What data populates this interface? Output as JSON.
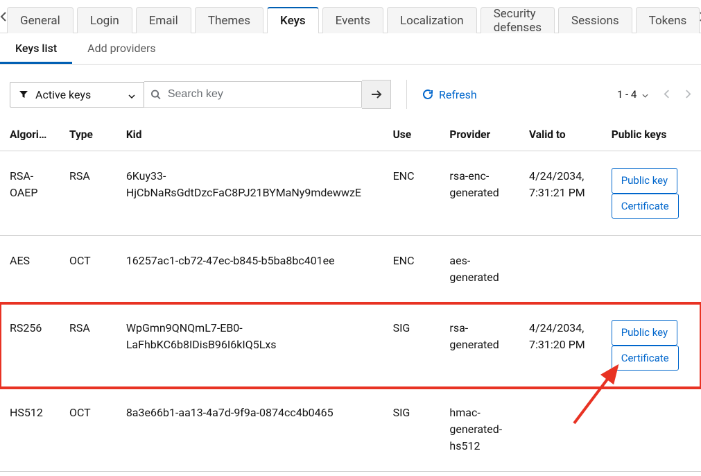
{
  "tabs": [
    "General",
    "Login",
    "Email",
    "Themes",
    "Keys",
    "Events",
    "Localization",
    "Security defenses",
    "Sessions",
    "Tokens"
  ],
  "activeTab": "Keys",
  "subtabs": [
    "Keys list",
    "Add providers"
  ],
  "activeSubtab": "Keys list",
  "filterLabel": "Active keys",
  "searchPlaceholder": "Search key",
  "refreshLabel": "Refresh",
  "rangeLabel": "1 - 4",
  "columns": {
    "algorithm": "Algori…",
    "type": "Type",
    "kid": "Kid",
    "use": "Use",
    "provider": "Provider",
    "validTo": "Valid to",
    "publicKeys": "Public keys"
  },
  "buttons": {
    "publicKey": "Public key",
    "certificate": "Certificate"
  },
  "rows": [
    {
      "algorithm": "RSA-OAEP",
      "type": "RSA",
      "kid": "6Kuy33-HjCbNaRsGdtDzcFaC8PJ21BYMaNy9mdewwzE",
      "use": "ENC",
      "provider": "rsa-enc-generated",
      "validTo": "4/24/2034, 7:31:21 PM",
      "hasKeys": true
    },
    {
      "algorithm": "AES",
      "type": "OCT",
      "kid": "16257ac1-cb72-47ec-b845-b5ba8bc401ee",
      "use": "ENC",
      "provider": "aes-generated",
      "validTo": "",
      "hasKeys": false
    },
    {
      "algorithm": "RS256",
      "type": "RSA",
      "kid": "WpGmn9QNQmL7-EB0-LaFhbKC6b8IDisB96I6kIQ5Lxs",
      "use": "SIG",
      "provider": "rsa-generated",
      "validTo": "4/24/2034, 7:31:20 PM",
      "hasKeys": true
    },
    {
      "algorithm": "HS512",
      "type": "OCT",
      "kid": "8a3e66b1-aa13-4a7d-9f9a-0874cc4b0465",
      "use": "SIG",
      "provider": "hmac-generated-hs512",
      "validTo": "",
      "hasKeys": false
    }
  ],
  "highlightIndex": 2
}
